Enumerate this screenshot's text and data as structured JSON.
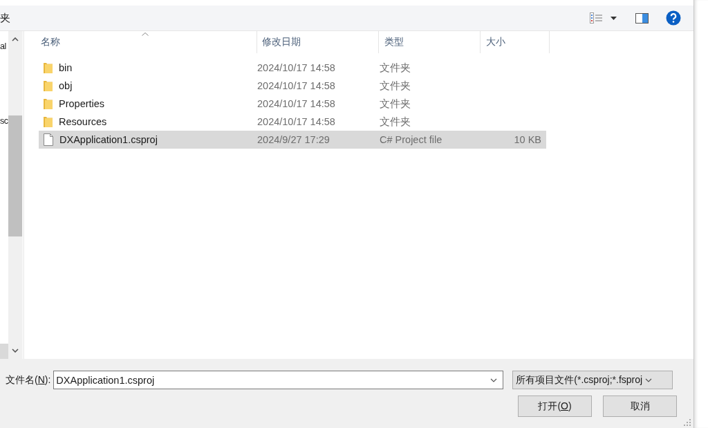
{
  "toolbar": {
    "title_fragment": "夹"
  },
  "nav_pane": {
    "items": [
      "al",
      "sc"
    ]
  },
  "file_list": {
    "columns": [
      {
        "label": "名称",
        "sorted": true
      },
      {
        "label": "修改日期",
        "sorted": false
      },
      {
        "label": "类型",
        "sorted": false
      },
      {
        "label": "大小",
        "sorted": false
      }
    ],
    "rows": [
      {
        "kind": "folder",
        "name": "bin",
        "modified": "2024/10/17 14:58",
        "type": "文件夹",
        "selected": false
      },
      {
        "kind": "folder",
        "name": "obj",
        "modified": "2024/10/17 14:58",
        "type": "文件夹",
        "selected": false
      },
      {
        "kind": "folder",
        "name": "Properties",
        "modified": "2024/10/17 14:58",
        "type": "文件夹",
        "selected": false
      },
      {
        "kind": "folder",
        "name": "Resources",
        "modified": "2024/10/17 14:58",
        "type": "文件夹",
        "selected": false
      },
      {
        "kind": "file",
        "name": "DXApplication1.csproj",
        "modified": "2024/9/27 17:29",
        "type": "C# Project file",
        "size": "10 KB",
        "selected": true
      }
    ]
  },
  "footer": {
    "file_name": {
      "label": "文件名(",
      "access_key": "N",
      "label_after": "):",
      "value": "DXApplication1.csproj"
    },
    "file_type_filter": "所有项目文件(*.csproj;*.fsproj",
    "buttons": [
      {
        "label": "打开(",
        "access_key": "O",
        "label_after": ")"
      },
      {
        "label": "取消"
      }
    ]
  }
}
